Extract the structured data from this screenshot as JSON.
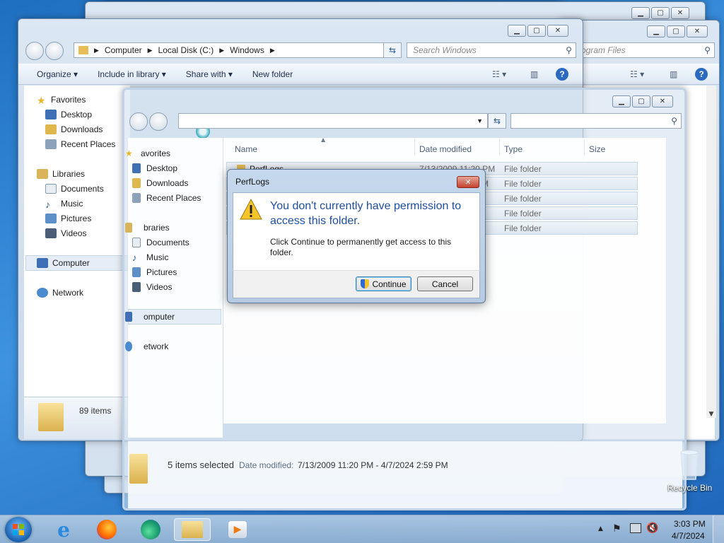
{
  "window_back": {
    "search_placeholder": "rogram Files"
  },
  "window_main": {
    "breadcrumb": [
      "Computer",
      "Local Disk (C:)",
      "Windows"
    ],
    "search_placeholder": "Search Windows",
    "toolbar": {
      "organize": "Organize",
      "include_in_library": "Include in library",
      "share_with": "Share with",
      "new_folder": "New folder"
    },
    "nav": {
      "favorites": "Favorites",
      "desktop": "Desktop",
      "downloads": "Downloads",
      "recent_places": "Recent Places",
      "libraries": "Libraries",
      "documents": "Documents",
      "music": "Music",
      "pictures": "Pictures",
      "videos": "Videos",
      "computer": "Computer",
      "network": "Network"
    },
    "status": "89 items"
  },
  "window_front": {
    "nav": {
      "favorites": "avorites",
      "desktop": "Desktop",
      "downloads": "Downloads",
      "recent_places": "Recent Places",
      "libraries": "braries",
      "documents": "Documents",
      "music": "Music",
      "pictures": "Pictures",
      "videos": "Videos",
      "computer": "omputer",
      "network": "etwork"
    },
    "columns": {
      "name": "Name",
      "date_modified": "Date modified",
      "type": "Type",
      "size": "Size"
    },
    "rows": [
      {
        "name": "PerfLogs",
        "date": "7/13/2009 11:20 PM",
        "type": "File folder"
      },
      {
        "name": "",
        "date": "PM",
        "type": "File folder"
      },
      {
        "name": "",
        "date": "",
        "type": "File folder"
      },
      {
        "name": "",
        "date": "",
        "type": "File folder"
      },
      {
        "name": "",
        "date": "",
        "type": "File folder"
      }
    ],
    "details": {
      "selected": "5 items selected",
      "date_label": "Date modified:",
      "date_range": "7/13/2009 11:20 PM - 4/7/2024 2:59 PM"
    }
  },
  "dialog": {
    "title": "PerfLogs",
    "heading": "You don't currently have permission to access this folder.",
    "body": "Click Continue to permanently get access to this folder.",
    "continue_label": "Continue",
    "cancel_label": "Cancel"
  },
  "desktop": {
    "recycle_bin": "Recycle Bin"
  },
  "taskbar": {
    "time": "3:03 PM",
    "date": "4/7/2024"
  },
  "icons": {
    "window_controls": [
      "minimize-icon",
      "maximize-icon",
      "close-icon"
    ],
    "start": "windows-orb-icon",
    "taskbar": [
      "internet-explorer-icon",
      "firefox-icon",
      "edge-icon",
      "file-explorer-icon",
      "media-player-icon"
    ]
  },
  "colors": {
    "accent_blue": "#1f5fa8",
    "heading_blue": "#1f4fa0",
    "desktop": "#2c7fd0"
  }
}
